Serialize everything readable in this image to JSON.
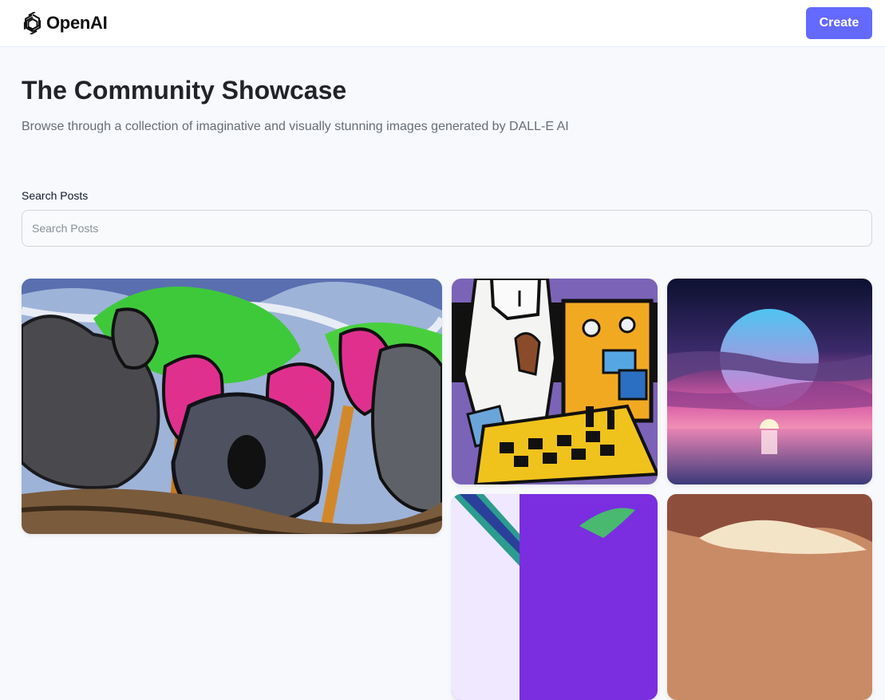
{
  "header": {
    "brand": "OpenAI",
    "logo_icon": "openai-logo-icon",
    "create_label": "Create",
    "accent_color": "#6469ff"
  },
  "main": {
    "title": "The Community Showcase",
    "subtitle": "Browse through a collection of imaginative and visually stunning images generated by DALL-E AI",
    "search": {
      "label": "Search Posts",
      "placeholder": "Search Posts",
      "value": ""
    }
  },
  "gallery": {
    "cards": [
      {
        "name": "koala-painting-card",
        "subject": "koala-painting"
      },
      {
        "name": "chess-player-card",
        "subject": "cubist-chess-player"
      },
      {
        "name": "sunset-ocean-card",
        "subject": "sunset-over-ocean"
      },
      {
        "name": "abstract-purple-card",
        "subject": "abstract-purple"
      },
      {
        "name": "cloudy-sky-card",
        "subject": "cloudy-sky"
      }
    ]
  }
}
